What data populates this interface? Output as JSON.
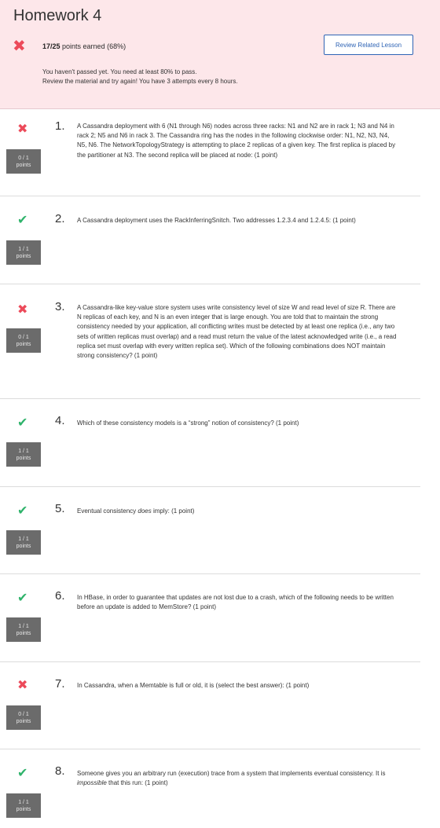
{
  "header": {
    "title": "Homework 4",
    "score": "17/25",
    "score_suffix": " points earned (68%)",
    "review_button": "Review Related Lesson",
    "message_line1": "You haven't passed yet. You need at least 80% to pass.",
    "message_line2": "Review the material and try again!  You have 3 attempts every 8 hours."
  },
  "colors": {
    "wrong": "#ec4a5a",
    "right": "#2fb36b",
    "banner": "#fde7ea",
    "button": "#2f64b5"
  },
  "questions": [
    {
      "num": "1.",
      "status": "wrong",
      "pts": "0 / 1",
      "pts_label": "points",
      "text": "A Cassandra deployment with 6 (N1 through N6) nodes across three racks: N1 and N2 are in rack 1; N3 and N4 in rack 2; N5 and N6 in rack 3. The Cassandra ring has the nodes in the following clockwise order: N1, N2, N3, N4, N5, N6. The NetworkTopologyStrategy is attempting to place 2 replicas of a given key. The first replica is placed by the partitioner at N3. The second replica will be placed at node: (1 point)"
    },
    {
      "num": "2.",
      "status": "right",
      "pts": "1 / 1",
      "pts_label": "points",
      "text": "A Cassandra deployment uses the RackInferringSnitch. Two addresses 1.2.3.4 and 1.2.4.5: (1 point)"
    },
    {
      "num": "3.",
      "status": "wrong",
      "pts": "0 / 1",
      "pts_label": "points",
      "text": "A Cassandra-like key-value store system uses write consistency level of size W and read level of size R. There are N replicas of each key, and N is an even integer that is large enough. You are told that to maintain the strong consistency needed by your application, all conflicting writes must be detected by at least one replica (i.e., any two sets of written replicas must overlap) and a read must return the value of the latest acknowledged write (i.e., a read replica set must overlap with every written replica set). Which of the following combinations does NOT maintain strong consistency? (1 point)"
    },
    {
      "num": "4.",
      "status": "right",
      "pts": "1 / 1",
      "pts_label": "points",
      "text": "Which of these consistency models is a “strong” notion of consistency? (1 point)"
    },
    {
      "num": "5.",
      "status": "right",
      "pts": "1 / 1",
      "pts_label": "points",
      "text_a": "Eventual consistency ",
      "text_em": "does",
      "text_b": " imply: (1 point)"
    },
    {
      "num": "6.",
      "status": "right",
      "pts": "1 / 1",
      "pts_label": "points",
      "text": "In HBase, in order to guarantee that updates are not lost due to a crash, which of the following needs to be written before an update is added to MemStore? (1 point)"
    },
    {
      "num": "7.",
      "status": "wrong",
      "pts": "0 / 1",
      "pts_label": "points",
      "text": "In Cassandra, when a Memtable is full or old, it is (select the best answer): (1 point)"
    },
    {
      "num": "8.",
      "status": "right",
      "pts": "1 / 1",
      "pts_label": "points",
      "text_a": "Someone gives you an arbitrary run (execution) trace from a system that implements eventual consistency. It is ",
      "text_em": "impossible",
      "text_b": " that this run: (1 point)"
    }
  ],
  "icons": {
    "wrong": "✖",
    "right": "✔"
  }
}
